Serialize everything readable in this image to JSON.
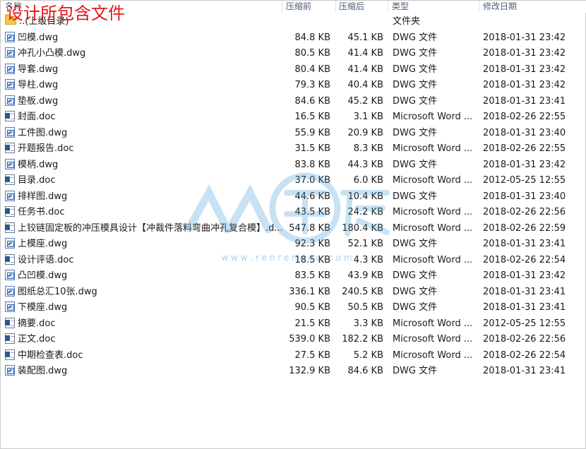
{
  "overlay_title": "设计所包含文件",
  "columns": {
    "name": "名称",
    "size_before": "压缩前",
    "size_after": "压缩后",
    "type": "类型",
    "modified": "修改日期"
  },
  "parent_row": {
    "name": "..(上级目录)",
    "type": "文件夹",
    "icon": "folder-icon"
  },
  "files": [
    {
      "name": "凹模.dwg",
      "before": "84.8 KB",
      "after": "45.1 KB",
      "type": "DWG 文件",
      "date": "2018-01-31 23:42",
      "kind": "dwg"
    },
    {
      "name": "冲孔小凸模.dwg",
      "before": "80.5 KB",
      "after": "41.4 KB",
      "type": "DWG 文件",
      "date": "2018-01-31 23:42",
      "kind": "dwg"
    },
    {
      "name": "导套.dwg",
      "before": "80.4 KB",
      "after": "41.4 KB",
      "type": "DWG 文件",
      "date": "2018-01-31 23:42",
      "kind": "dwg"
    },
    {
      "name": "导柱.dwg",
      "before": "79.3 KB",
      "after": "40.4 KB",
      "type": "DWG 文件",
      "date": "2018-01-31 23:42",
      "kind": "dwg"
    },
    {
      "name": "垫板.dwg",
      "before": "84.6 KB",
      "after": "45.2 KB",
      "type": "DWG 文件",
      "date": "2018-01-31 23:41",
      "kind": "dwg"
    },
    {
      "name": "封面.doc",
      "before": "16.5 KB",
      "after": "3.1 KB",
      "type": "Microsoft Word ...",
      "date": "2018-02-26 22:55",
      "kind": "doc"
    },
    {
      "name": "工件图.dwg",
      "before": "55.9 KB",
      "after": "20.9 KB",
      "type": "DWG 文件",
      "date": "2018-01-31 23:40",
      "kind": "dwg"
    },
    {
      "name": "开题报告.doc",
      "before": "31.5 KB",
      "after": "8.3 KB",
      "type": "Microsoft Word ...",
      "date": "2018-02-26 22:55",
      "kind": "doc"
    },
    {
      "name": "模柄.dwg",
      "before": "83.8 KB",
      "after": "44.3 KB",
      "type": "DWG 文件",
      "date": "2018-01-31 23:42",
      "kind": "dwg"
    },
    {
      "name": "目录.doc",
      "before": "37.0 KB",
      "after": "6.0 KB",
      "type": "Microsoft Word ...",
      "date": "2012-05-25 12:55",
      "kind": "doc"
    },
    {
      "name": "排样图.dwg",
      "before": "44.6 KB",
      "after": "10.4 KB",
      "type": "DWG 文件",
      "date": "2018-01-31 23:40",
      "kind": "dwg"
    },
    {
      "name": "任务书.doc",
      "before": "43.5 KB",
      "after": "24.2 KB",
      "type": "Microsoft Word ...",
      "date": "2018-02-26 22:56",
      "kind": "doc"
    },
    {
      "name": "上铰链固定板的冲压模具设计【冲裁件落料弯曲冲孔复合模】.d...",
      "before": "547.8 KB",
      "after": "180.4 KB",
      "type": "Microsoft Word ...",
      "date": "2018-02-26 22:59",
      "kind": "doc"
    },
    {
      "name": "上模座.dwg",
      "before": "92.3 KB",
      "after": "52.1 KB",
      "type": "DWG 文件",
      "date": "2018-01-31 23:41",
      "kind": "dwg"
    },
    {
      "name": "设计评语.doc",
      "before": "18.5 KB",
      "after": "4.3 KB",
      "type": "Microsoft Word ...",
      "date": "2018-02-26 22:54",
      "kind": "doc"
    },
    {
      "name": "凸凹模.dwg",
      "before": "83.5 KB",
      "after": "43.9 KB",
      "type": "DWG 文件",
      "date": "2018-01-31 23:42",
      "kind": "dwg"
    },
    {
      "name": "图纸总汇10张.dwg",
      "before": "336.1 KB",
      "after": "240.5 KB",
      "type": "DWG 文件",
      "date": "2018-01-31 23:41",
      "kind": "dwg"
    },
    {
      "name": "下模座.dwg",
      "before": "90.5 KB",
      "after": "50.5 KB",
      "type": "DWG 文件",
      "date": "2018-01-31 23:41",
      "kind": "dwg"
    },
    {
      "name": "摘要.doc",
      "before": "21.5 KB",
      "after": "3.3 KB",
      "type": "Microsoft Word ...",
      "date": "2012-05-25 12:55",
      "kind": "doc"
    },
    {
      "name": "正文.doc",
      "before": "539.0 KB",
      "after": "182.2 KB",
      "type": "Microsoft Word ...",
      "date": "2018-02-26 22:56",
      "kind": "doc"
    },
    {
      "name": "中期检查表.doc",
      "before": "27.5 KB",
      "after": "5.2 KB",
      "type": "Microsoft Word ...",
      "date": "2018-02-26 22:54",
      "kind": "doc"
    },
    {
      "name": "装配图.dwg",
      "before": "132.9 KB",
      "after": "84.6 KB",
      "type": "DWG 文件",
      "date": "2018-01-31 23:41",
      "kind": "dwg"
    }
  ],
  "watermark": {
    "url": "w w w . r e n r e n d o c . c o m",
    "color": "#3d9ad6"
  }
}
